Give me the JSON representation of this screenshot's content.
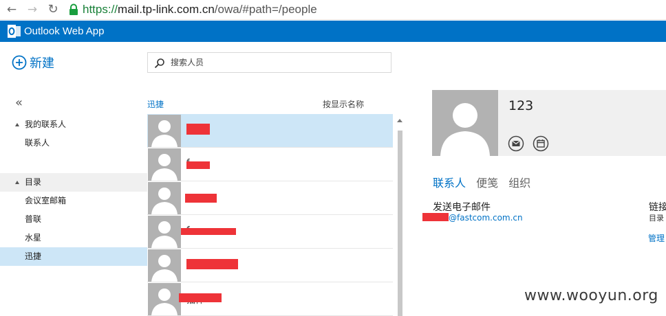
{
  "browser": {
    "url_scheme": "https://",
    "url_host": "mail.tp-link.com.cn",
    "url_path": "/owa/#path=/people"
  },
  "app": {
    "title": "Outlook Web App",
    "accent": "#0072c6"
  },
  "toolbar": {
    "new_label": "新建"
  },
  "search": {
    "placeholder": "搜索人员"
  },
  "nav": {
    "collapse_glyph": "«",
    "my_contacts_group": "我的联系人",
    "contacts_item": "联系人",
    "directory_group": "目录",
    "directory_items": [
      "会议室邮箱",
      "普联",
      "水星",
      "迅捷"
    ],
    "selected_item": "迅捷"
  },
  "list": {
    "folder_label": "迅捷",
    "sort_label": "按显示名称",
    "rows": [
      {
        "name": "",
        "selected": true
      },
      {
        "name": "f",
        "selected": false
      },
      {
        "name": "",
        "selected": false
      },
      {
        "name": "f   ",
        "selected": false
      },
      {
        "name": "",
        "selected": false
      },
      {
        "name": "    插件",
        "selected": false
      }
    ]
  },
  "detail": {
    "name": "123",
    "tabs": [
      "联系人",
      "便笺",
      "组织"
    ],
    "active_tab": "联系人",
    "send_email_label": "发送电子邮件",
    "email_domain": "@fastcom.com.cn",
    "link_label": "链接",
    "dir_label": "目录",
    "manage_label": "管理"
  },
  "watermark": "www.wooyun.org",
  "colors": {
    "selection": "#cde6f7",
    "redaction": "#ee3338",
    "avatar_bg": "#b2b2b2"
  },
  "icons": [
    "back-arrow-icon",
    "forward-arrow-icon",
    "reload-icon",
    "lock-icon",
    "outlook-logo-icon",
    "plus-circle-icon",
    "search-icon",
    "person-silhouette-icon",
    "mail-icon",
    "calendar-icon"
  ]
}
